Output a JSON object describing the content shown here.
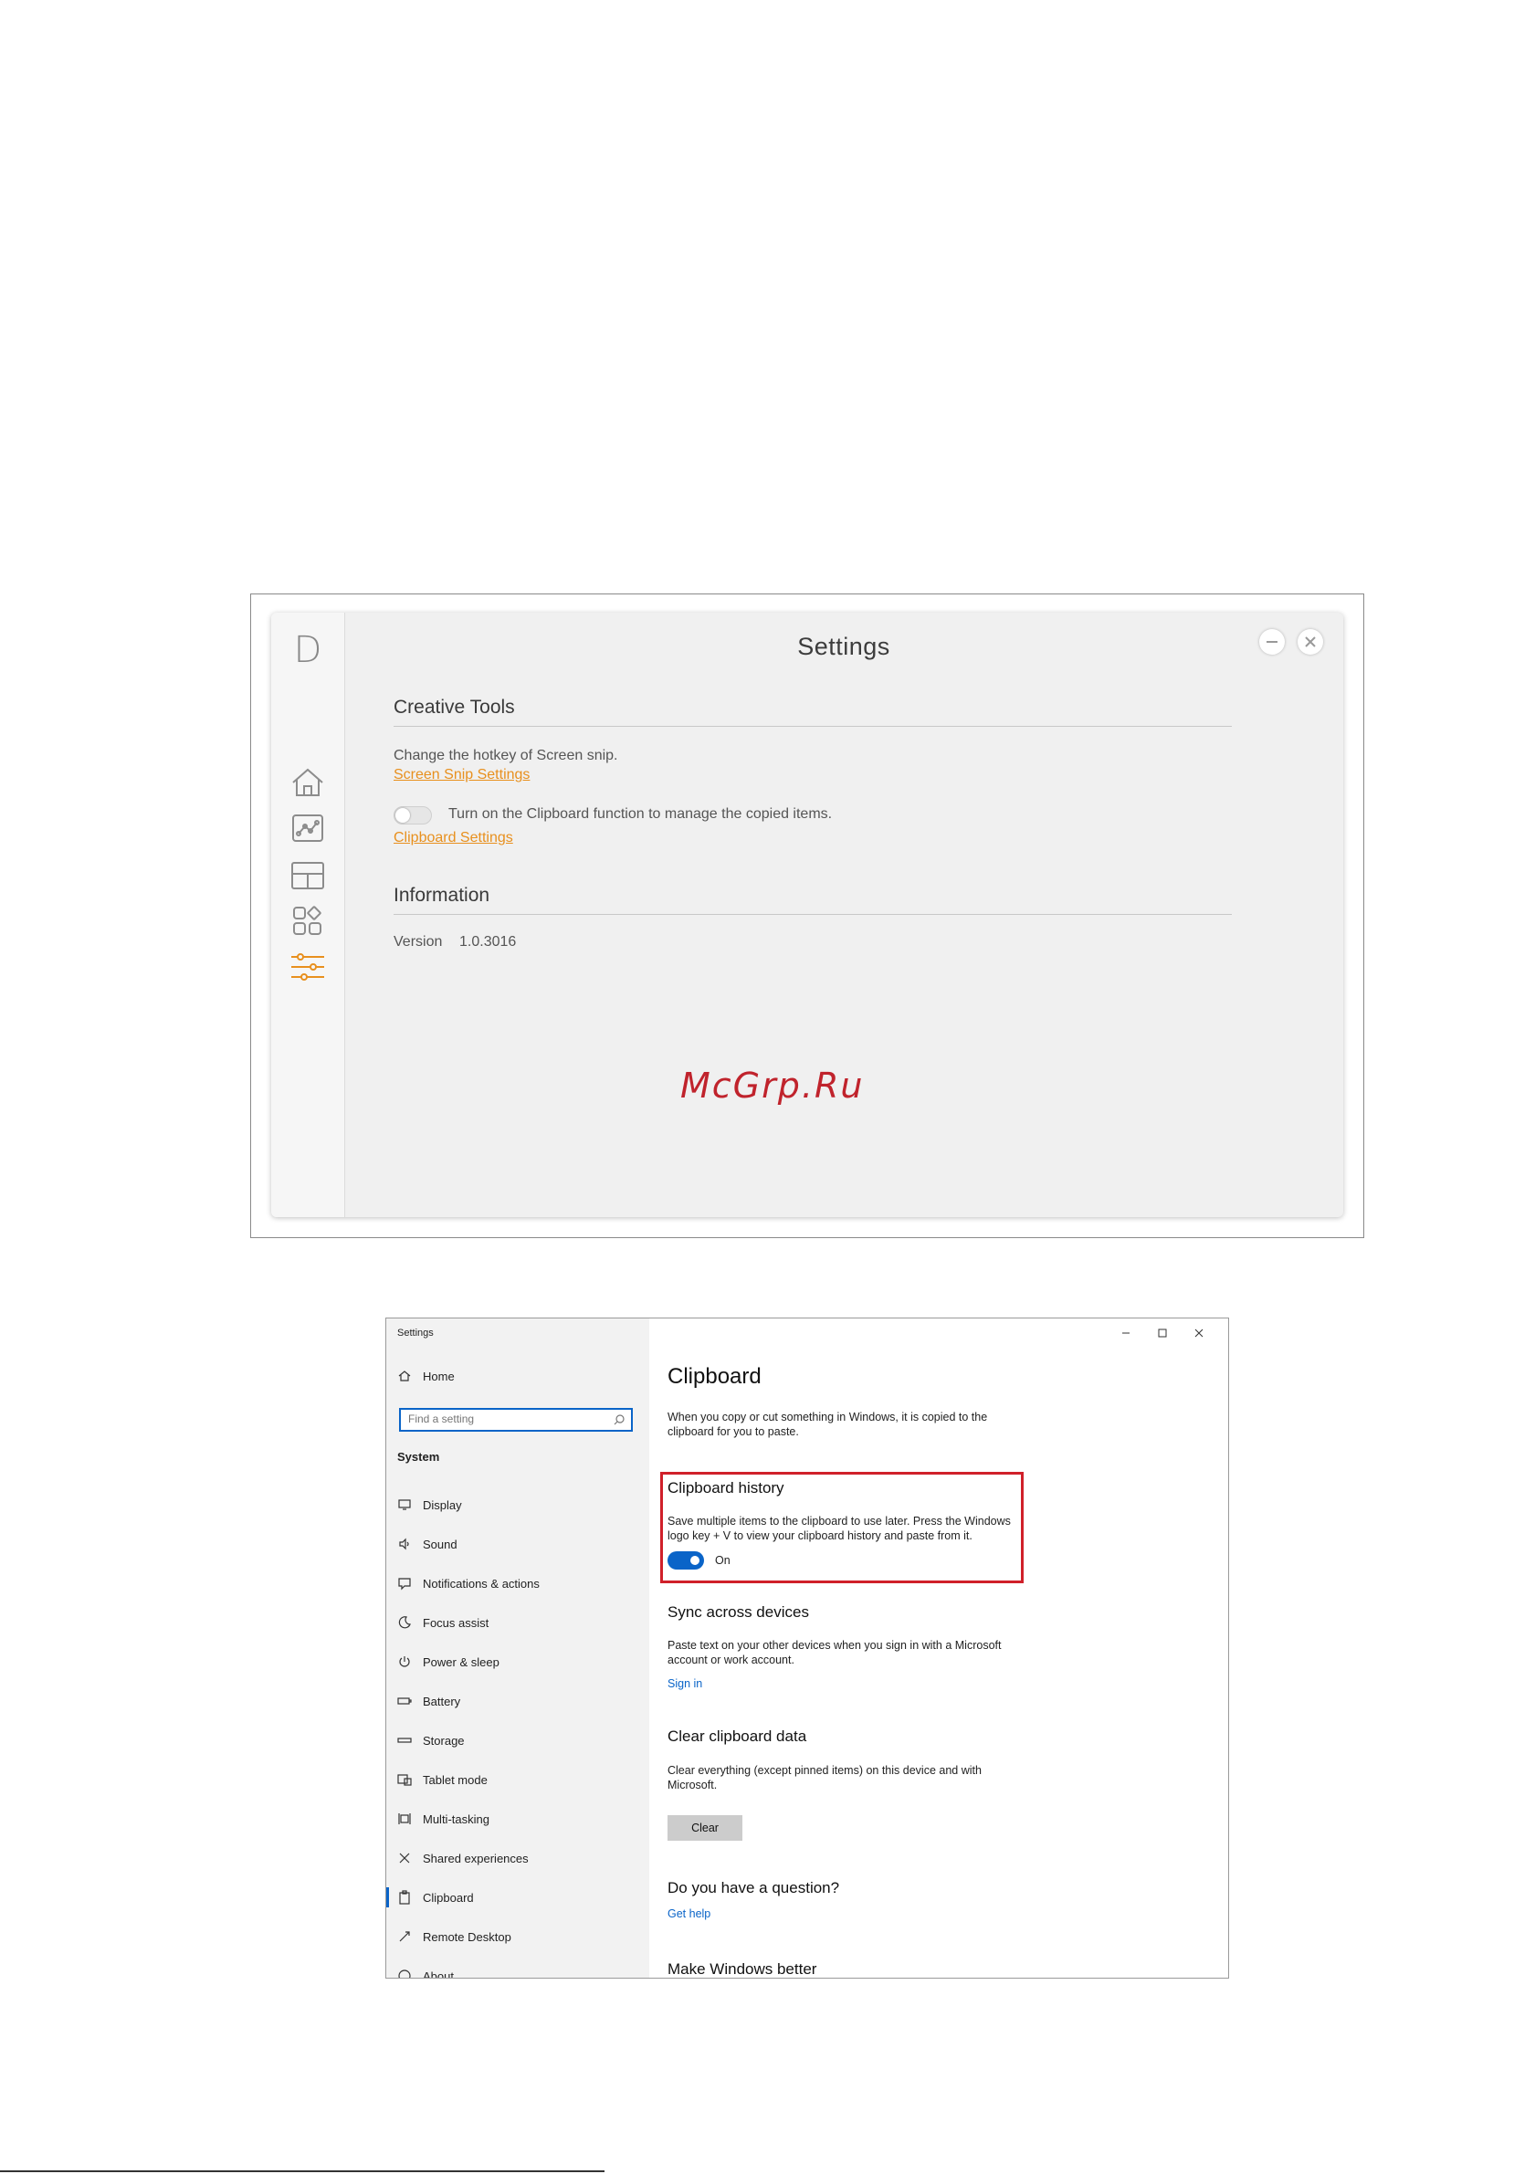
{
  "app1": {
    "logo": "D",
    "title": "Settings",
    "sidebar": [
      {
        "icon": "home-icon"
      },
      {
        "icon": "chart-icon"
      },
      {
        "icon": "layout-icon"
      },
      {
        "icon": "apps-icon"
      },
      {
        "icon": "settings-sliders-icon",
        "active": true
      }
    ],
    "creative_tools": {
      "heading": "Creative Tools",
      "hotkey_text": "Change the hotkey of Screen snip.",
      "snip_link": "Screen Snip Settings",
      "clipboard_toggle_label": "Turn on the Clipboard function to manage the copied items.",
      "clipboard_link": "Clipboard Settings"
    },
    "information": {
      "heading": "Information",
      "version_label": "Version",
      "version_value": "1.0.3016"
    },
    "accent": "#e8901e"
  },
  "watermark": "McGrp.Ru",
  "win": {
    "title": "Settings",
    "sidebar": {
      "home": "Home",
      "search_placeholder": "Find a setting",
      "group": "System",
      "items": [
        "Display",
        "Sound",
        "Notifications & actions",
        "Focus assist",
        "Power & sleep",
        "Battery",
        "Storage",
        "Tablet mode",
        "Multi-tasking",
        "Shared experiences",
        "Clipboard",
        "Remote Desktop",
        "About"
      ]
    },
    "main": {
      "title": "Clipboard",
      "intro": "When you copy or cut something in Windows, it is copied to the clipboard for you to paste.",
      "history_heading": "Clipboard history",
      "history_text": "Save multiple items to the clipboard to use later. Press the Windows logo key + V to view your clipboard history and paste from it.",
      "history_toggle": "On",
      "sync_heading": "Sync across devices",
      "sync_text": "Paste text on your other devices when you sign in with a Microsoft account or work account.",
      "sync_link": "Sign in",
      "clear_heading": "Clear clipboard data",
      "clear_text": "Clear everything (except pinned items) on this device and with Microsoft.",
      "clear_button": "Clear",
      "question_heading": "Do you have a question?",
      "help_link": "Get help",
      "better_heading": "Make Windows better"
    },
    "accent": "#0a64c8",
    "highlight": "#d0202a"
  }
}
